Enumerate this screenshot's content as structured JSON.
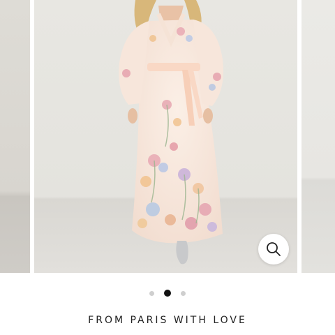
{
  "product": {
    "title": "FROM PARIS WITH LOVE"
  },
  "carousel": {
    "total_slides": 3,
    "active_index": 1,
    "slides": [
      {
        "name": "previous-product-photo"
      },
      {
        "name": "main-product-photo"
      },
      {
        "name": "next-product-photo"
      }
    ]
  },
  "icons": {
    "zoom": "magnifier-icon"
  },
  "colors": {
    "dot_active": "#111111",
    "dot_inactive": "#cfcfcf",
    "background": "#ffffff"
  }
}
